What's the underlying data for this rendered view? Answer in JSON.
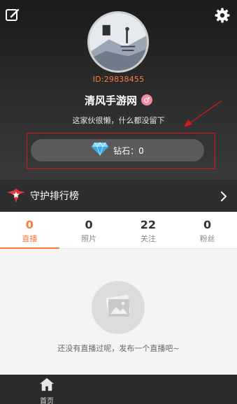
{
  "profile": {
    "user_id": "ID:29838455",
    "username": "清风手游网",
    "bio": "这家伙很懒，什么都没留下"
  },
  "diamond": {
    "label": "钻石：0"
  },
  "guard": {
    "title": "守护排行榜"
  },
  "stats": [
    {
      "count": "0",
      "label": "直播",
      "active": true
    },
    {
      "count": "0",
      "label": "照片",
      "active": false
    },
    {
      "count": "22",
      "label": "关注",
      "active": false
    },
    {
      "count": "0",
      "label": "粉丝",
      "active": false
    }
  ],
  "empty_state": {
    "text": "还没有直播过呢，发布一个直播吧~"
  },
  "bottom_nav": {
    "home_label": "首页"
  },
  "colors": {
    "accent": "#ff7b3a",
    "annotation": "#d11d1d",
    "dark_bg": "#2e2e2f"
  },
  "icons": [
    "edit-icon",
    "gear-icon",
    "gender-icon",
    "diamond-icon",
    "guard-icon",
    "chevron-right-icon",
    "image-placeholder-icon",
    "home-icon"
  ]
}
